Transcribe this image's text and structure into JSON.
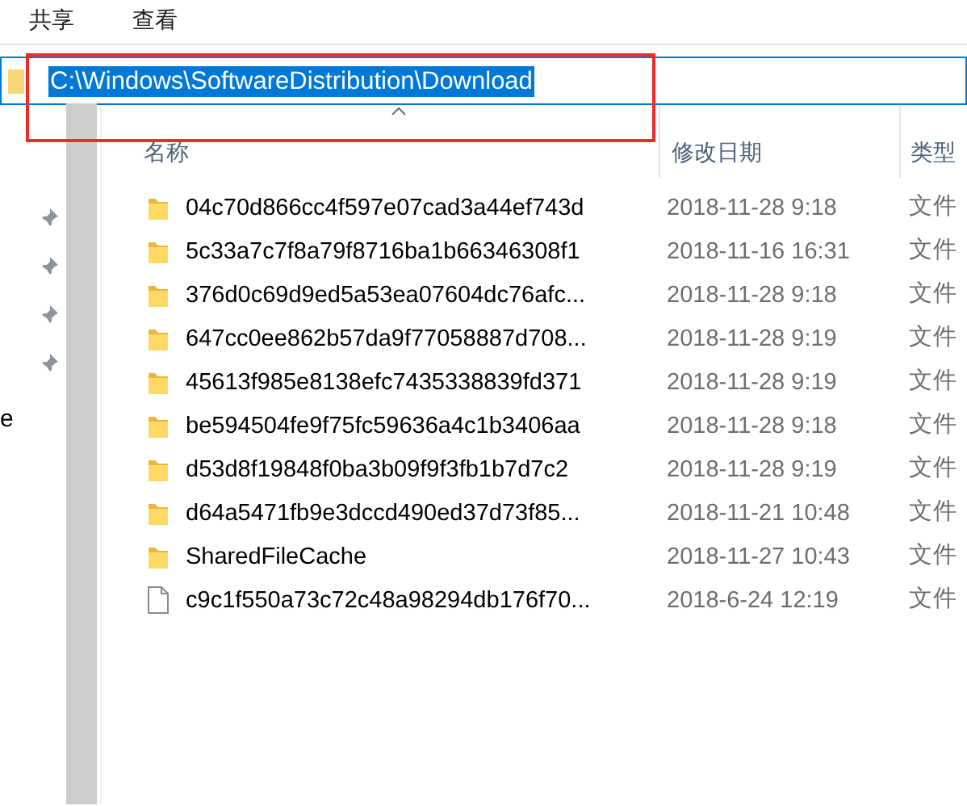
{
  "ribbon_tabs": [
    {
      "label": "共享"
    },
    {
      "label": "查看"
    }
  ],
  "address_bar": {
    "path": "C:\\Windows\\SoftwareDistribution\\Download",
    "selected": true
  },
  "navigation_pane": {
    "visible_text": "e"
  },
  "file_list": {
    "columns": [
      {
        "label": "名称",
        "sorted": true
      },
      {
        "label": "修改日期",
        "sorted": false
      },
      {
        "label": "类型",
        "sorted": false
      }
    ],
    "rows": [
      {
        "kind": "folder",
        "name": "04c70d866cc4f597e07cad3a44ef743d",
        "modified": "2018-11-28 9:18",
        "type": "文件"
      },
      {
        "kind": "folder",
        "name": "5c33a7c7f8a79f8716ba1b66346308f1",
        "modified": "2018-11-16 16:31",
        "type": "文件"
      },
      {
        "kind": "folder",
        "name": "376d0c69d9ed5a53ea07604dc76afc...",
        "modified": "2018-11-28 9:18",
        "type": "文件"
      },
      {
        "kind": "folder",
        "name": "647cc0ee862b57da9f77058887d708...",
        "modified": "2018-11-28 9:19",
        "type": "文件"
      },
      {
        "kind": "folder",
        "name": "45613f985e8138efc7435338839fd371",
        "modified": "2018-11-28 9:19",
        "type": "文件"
      },
      {
        "kind": "folder",
        "name": "be594504fe9f75fc59636a4c1b3406aa",
        "modified": "2018-11-28 9:18",
        "type": "文件"
      },
      {
        "kind": "folder",
        "name": "d53d8f19848f0ba3b09f9f3fb1b7d7c2",
        "modified": "2018-11-28 9:19",
        "type": "文件"
      },
      {
        "kind": "folder",
        "name": "d64a5471fb9e3dccd490ed37d73f85...",
        "modified": "2018-11-21 10:48",
        "type": "文件"
      },
      {
        "kind": "folder",
        "name": "SharedFileCache",
        "modified": "2018-11-27 10:43",
        "type": "文件"
      },
      {
        "kind": "file",
        "name": "c9c1f550a73c72c48a98294db176f70...",
        "modified": "2018-6-24 12:19",
        "type": "文件"
      }
    ]
  }
}
